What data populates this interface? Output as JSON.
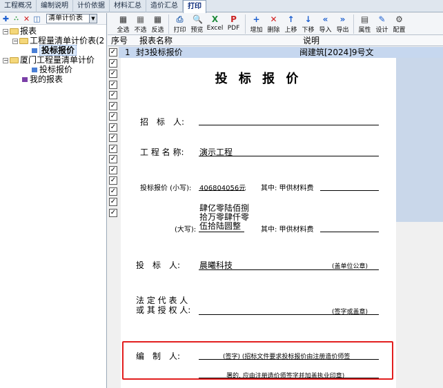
{
  "tabs": [
    "工程概况",
    "编制说明",
    "计价依据",
    "材料汇总",
    "造价汇总",
    "打印"
  ],
  "active_tab": "打印",
  "left_toolbar": {
    "icons": [
      "add-icon",
      "tree-add-icon",
      "delete-icon",
      "split-icon"
    ],
    "combo_value": "清单计价表"
  },
  "tree": {
    "root": "报表",
    "group1": "工程量清单计价表(2",
    "group1_item": "投标报价",
    "group2": "厦门工程量清单计价",
    "group2_item": "投标报价",
    "mine": "我的报表"
  },
  "toolbar": [
    {
      "label": "全选",
      "icon": "select-all-icon",
      "glyph": "▦",
      "color": "#333"
    },
    {
      "label": "不选",
      "icon": "select-none-icon",
      "glyph": "▦",
      "color": "#666"
    },
    {
      "label": "反选",
      "icon": "invert-select-icon",
      "glyph": "▦",
      "color": "#333"
    },
    {
      "label": "打印",
      "icon": "print-icon",
      "glyph": "⎙",
      "color": "#3b6fb5"
    },
    {
      "label": "预览",
      "icon": "preview-icon",
      "glyph": "🔍",
      "color": "#555"
    },
    {
      "label": "Excel",
      "icon": "excel-icon",
      "glyph": "X",
      "color": "#1f8b3a"
    },
    {
      "label": "PDF",
      "icon": "pdf-icon",
      "glyph": "P",
      "color": "#c22"
    },
    {
      "label": "增加",
      "icon": "add-icon",
      "glyph": "+",
      "color": "#1d5fcf"
    },
    {
      "label": "删除",
      "icon": "delete-icon",
      "glyph": "✕",
      "color": "#d21c1c"
    },
    {
      "label": "上移",
      "icon": "move-up-icon",
      "glyph": "↑",
      "color": "#1d5fcf"
    },
    {
      "label": "下移",
      "icon": "move-down-icon",
      "glyph": "↓",
      "color": "#1d5fcf"
    },
    {
      "label": "导入",
      "icon": "import-icon",
      "glyph": "«",
      "color": "#1d5fcf"
    },
    {
      "label": "导出",
      "icon": "export-icon",
      "glyph": "»",
      "color": "#1d5fcf"
    },
    {
      "label": "属性",
      "icon": "properties-icon",
      "glyph": "▤",
      "color": "#444"
    },
    {
      "label": "设计",
      "icon": "design-icon",
      "glyph": "✎",
      "color": "#1d5fcf"
    },
    {
      "label": "配置",
      "icon": "config-icon",
      "glyph": "⚙",
      "color": "#444"
    }
  ],
  "list": {
    "headers": {
      "seq": "序号",
      "name": "报表名称",
      "desc": "说明"
    },
    "row": {
      "seq": "1",
      "name": "封3投标报价",
      "desc": "闽建筑[2024]9号文"
    },
    "checkbox_count": 16
  },
  "report": {
    "title": "投 标 报 价",
    "tenderer_label": "招　标　人:",
    "project_label": "工 程 名 称:",
    "project_value": "演示工程",
    "price_label": "投标报价 (小写):",
    "price_value": "406804056元",
    "supply_label1": "其中: 甲供材料费",
    "upper_label": "(大写):",
    "upper_value_1": "肆亿零陆佰捌",
    "upper_value_2": "拾万零肆仟零",
    "upper_value_3": "伍拾陆圆整",
    "supply_label2": "其中: 甲供材料费",
    "bidder_label": "投　标　人:",
    "bidder_value": "晨曦科技",
    "bidder_note": "(盖单位公章)",
    "legal_label_1": "法 定 代 表 人",
    "legal_label_2": "或 其 授 权 人:",
    "legal_note": "(签字或盖章)",
    "compiler_label": "编　制　人:",
    "compiler_note_1": "(签字) (招标文件要求投标报价由注册造价师签",
    "compiler_note_2": "署的, 应由注册造价师签字并加盖执业印章)"
  }
}
